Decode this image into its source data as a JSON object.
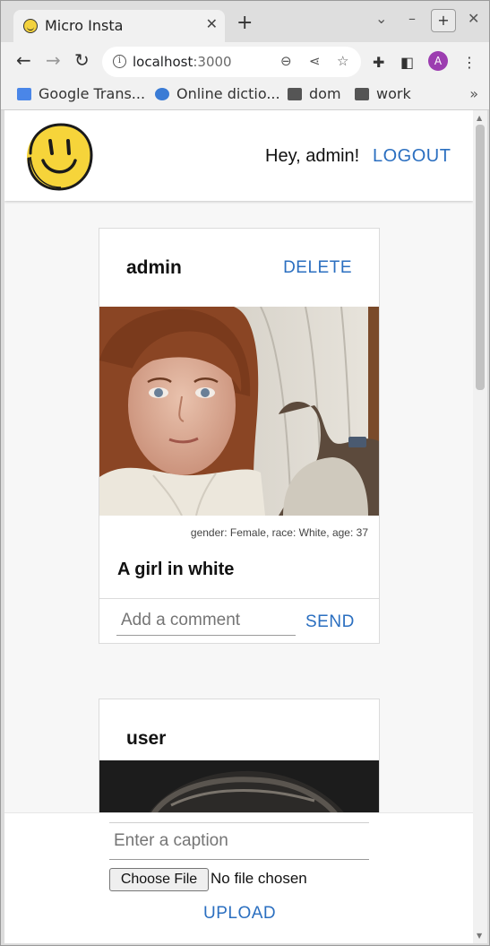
{
  "browser": {
    "tab_title": "Micro Insta",
    "tab_close": "✕",
    "new_tab": "+",
    "url_host": "localhost",
    "url_port": ":3000",
    "bookmarks": [
      {
        "label": "Google Trans...",
        "icon": "google-translate-icon"
      },
      {
        "label": "Online dictio...",
        "icon": "dictionary-icon"
      },
      {
        "label": "dom",
        "icon": "folder-icon"
      },
      {
        "label": "work",
        "icon": "folder-icon"
      }
    ],
    "bookmarks_more": "»",
    "profile_initial": "A",
    "profile_color": "#9c3db0"
  },
  "header": {
    "greeting": "Hey, admin!",
    "logout_label": "LOGOUT"
  },
  "posts": [
    {
      "author": "admin",
      "delete_label": "DELETE",
      "meta": "gender: Female, race: White, age: 37",
      "caption": "A girl in white",
      "comment_placeholder": "Add a comment",
      "send_label": "SEND"
    },
    {
      "author": "user"
    }
  ],
  "upload": {
    "caption_placeholder": "Enter a caption",
    "choose_file_label": "Choose File",
    "no_file_text": "No file chosen",
    "upload_label": "UPLOAD"
  },
  "colors": {
    "accent": "#2b6fc0",
    "card_border": "#dbdbdb",
    "page_bg": "#f7f7f7"
  }
}
